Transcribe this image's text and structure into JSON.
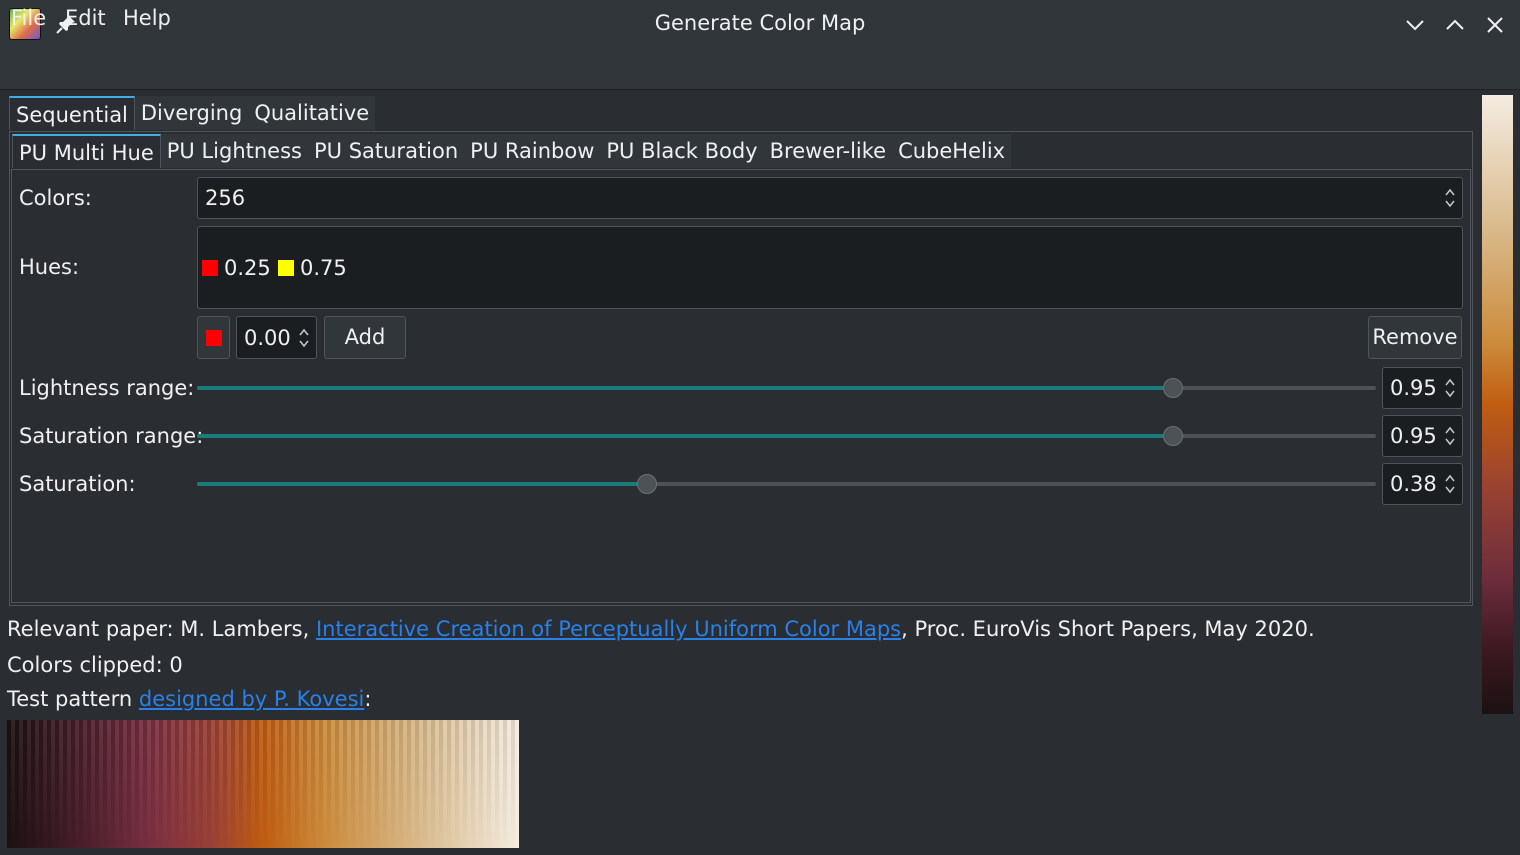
{
  "window": {
    "title": "Generate Color Map",
    "icons": {
      "app": "app-icon",
      "pin": "pin-icon",
      "minimize": "chevron-down-icon",
      "maximize": "chevron-up-icon",
      "close": "close-icon"
    }
  },
  "menu": {
    "items": [
      "File",
      "Edit",
      "Help"
    ]
  },
  "outer_tabs": {
    "items": [
      "Sequential",
      "Diverging",
      "Qualitative"
    ],
    "active": "Sequential"
  },
  "inner_tabs": {
    "items": [
      "PU Multi Hue",
      "PU Lightness",
      "PU Saturation",
      "PU Rainbow",
      "PU Black Body",
      "Brewer-like",
      "CubeHelix"
    ],
    "active": "PU Multi Hue"
  },
  "form": {
    "colors_label": "Colors:",
    "colors_value": "256",
    "hues_label": "Hues:",
    "hues": [
      {
        "color": "#ff0000",
        "value": "0.25"
      },
      {
        "color": "#ffff00",
        "value": "0.75"
      }
    ],
    "new_hue_color": "#ff0000",
    "new_hue_value": "0.00",
    "add_label": "Add",
    "remove_label": "Remove",
    "lightness_label": "Lightness range:",
    "lightness_value": "0.95",
    "saturation_range_label": "Saturation range:",
    "saturation_range_value": "0.95",
    "saturation_label": "Saturation:",
    "saturation_value": "0.38"
  },
  "info": {
    "paper_prefix": "Relevant paper: M. Lambers, ",
    "paper_link": "Interactive Creation of Perceptually Uniform Color Maps",
    "paper_suffix": ", Proc. EuroVis Short Papers, May 2020.",
    "clipped": "Colors clipped: 0",
    "pattern_prefix": "Test pattern ",
    "pattern_link": "designed by P. Kovesi",
    "pattern_suffix": ":"
  },
  "colors": {
    "accent": "#1d7b7b",
    "link": "#2980e6",
    "tab_highlight": "#3daee9"
  }
}
